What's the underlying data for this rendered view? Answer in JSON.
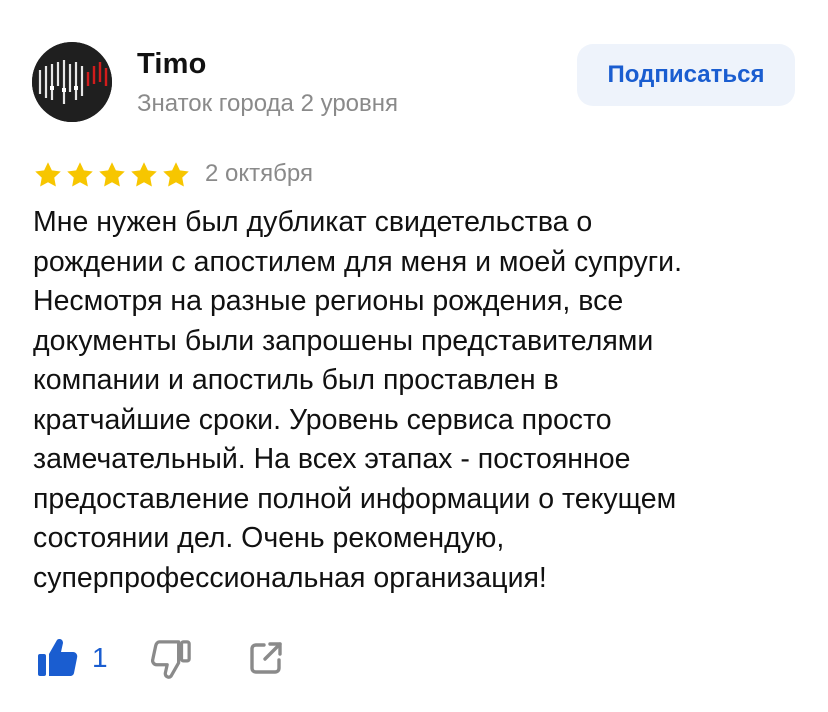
{
  "author": {
    "name": "Timo",
    "status": "Знаток города 2 уровня",
    "avatar_icon": "avatar-image"
  },
  "subscribe": {
    "label": "Подписаться"
  },
  "review": {
    "rating": 5,
    "rating_max": 5,
    "date": "2 октября",
    "text": "Мне нужен был дубликат свидетельства о\nрождении с апостилем для меня и моей супруги.\nНесмотря на разные регионы рождения, все\nдокументы были запрошены представителями\nкомпании и апостиль был проставлен в\nкратчайшие сроки.  Уровень сервиса просто\nзамечательный. На всех этапах - постоянное\nпредоставление полной информации о текущем\nсостоянии дел. Очень рекомендую,\nсуперпрофессиональная организация!"
  },
  "actions": {
    "like_count": "1",
    "like_icon": "thumbs-up-icon",
    "dislike_icon": "thumbs-down-icon",
    "share_icon": "share-icon"
  },
  "colors": {
    "accent_blue": "#1a5dd0",
    "star_gold": "#f7c600",
    "secondary_text": "#8a8a8a",
    "button_bg": "#eef3fb"
  }
}
